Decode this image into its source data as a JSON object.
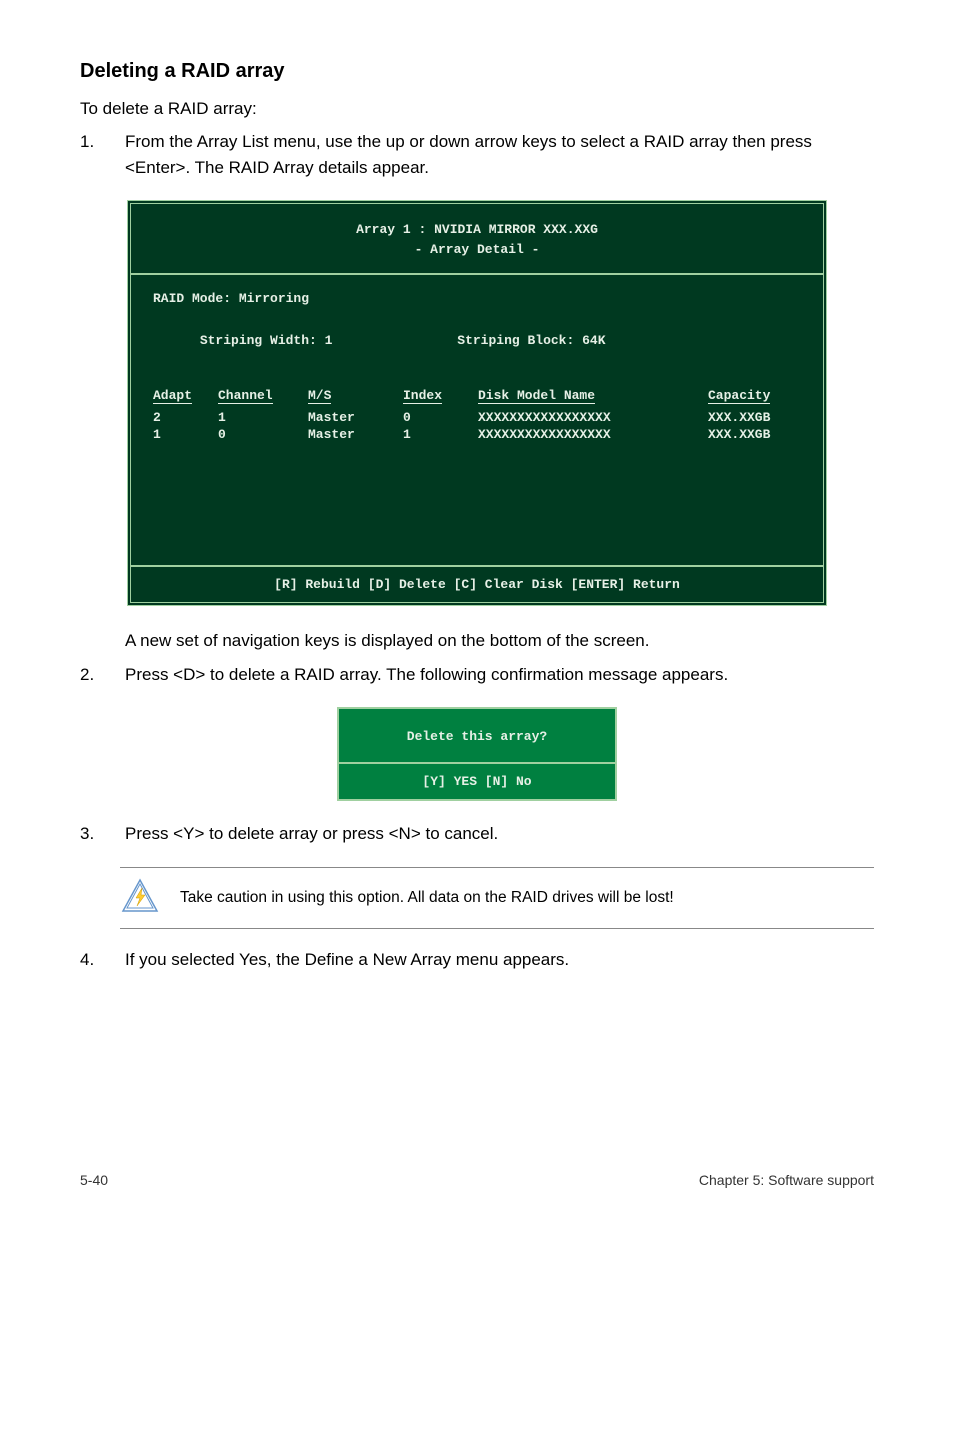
{
  "heading": "Deleting a RAID array",
  "intro": "To delete a RAID array:",
  "steps": {
    "s1": {
      "num": "1.",
      "text": "From the Array List menu, use the up or down arrow keys to select a RAID array then press <Enter>. The RAID Array details appear."
    },
    "s2a": "A new set of  navigation keys is displayed on the bottom of the screen.",
    "s2": {
      "num": "2.",
      "text": "Press <D> to delete a RAID array. The following confirmation message appears."
    },
    "s3": {
      "num": "3.",
      "text": "Press <Y> to delete array or press <N> to cancel."
    },
    "s4": {
      "num": "4.",
      "text": "If you selected Yes, the Define a New Array menu appears."
    }
  },
  "terminal": {
    "title1": "Array 1 : NVIDIA MIRROR  XXX.XXG",
    "title2": "- Array Detail -",
    "raid_mode": "RAID Mode: Mirroring",
    "strip_width": "Striping Width: 1",
    "strip_block": "Striping Block: 64K",
    "headers": {
      "adapt": "Adapt",
      "channel": "Channel",
      "ms": "M/S",
      "index": "Index",
      "disk": "Disk Model Name",
      "capacity": "Capacity"
    },
    "rows": [
      {
        "adapt": "2",
        "channel": "1",
        "ms": "Master",
        "index": "0",
        "disk": "XXXXXXXXXXXXXXXXX",
        "cap": "XXX.XXGB"
      },
      {
        "adapt": "1",
        "channel": "0",
        "ms": "Master",
        "index": "1",
        "disk": "XXXXXXXXXXXXXXXXX",
        "cap": "XXX.XXGB"
      }
    ],
    "footer": "[R] Rebuild  [D] Delete  [C] Clear Disk  [ENTER] Return"
  },
  "dialog": {
    "question": "Delete this array?",
    "options": "[Y] YES   [N] No"
  },
  "callout": "Take caution in using this option. All data on the RAID drives will be lost!",
  "footer": {
    "left": "5-40",
    "right": "Chapter 5: Software support"
  }
}
